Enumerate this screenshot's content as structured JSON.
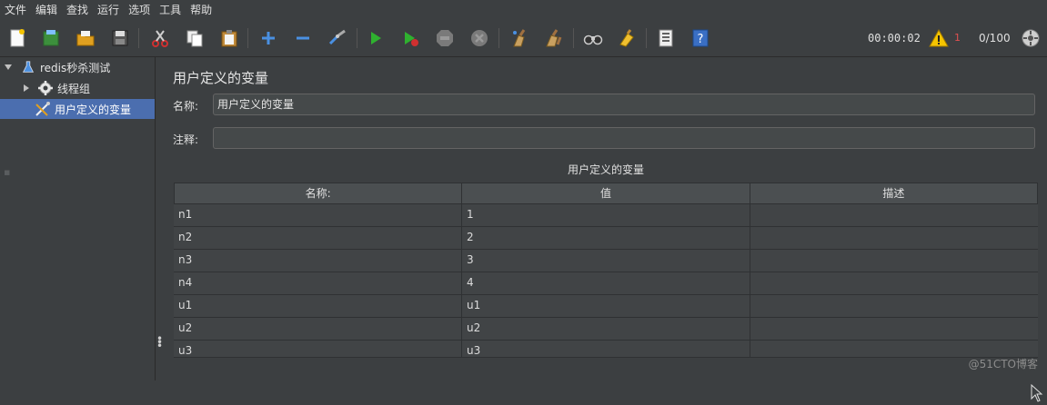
{
  "menu": [
    "文件",
    "编辑",
    "查找",
    "运行",
    "选项",
    "工具",
    "帮助"
  ],
  "toolbar": {
    "icons": [
      "new-icon",
      "templates-icon",
      "open-icon",
      "save-icon",
      "cut-icon",
      "copy-icon",
      "paste-icon",
      "expand-icon",
      "collapse-icon",
      "toggle-icon",
      "start-icon",
      "start-no-pause-icon",
      "stop-icon",
      "shutdown-icon",
      "clear-icon",
      "clear-all-icon",
      "search-icon",
      "reset-search-icon",
      "function-helper-icon",
      "help-icon"
    ],
    "timer": "00:00:02",
    "warn_count": "1",
    "threads": "0/100"
  },
  "tree": {
    "root": "redis秒杀测试",
    "thread_group": "线程组",
    "selected": "用户定义的变量"
  },
  "panel": {
    "title": "用户定义的变量",
    "name_label": "名称:",
    "name_value": "用户定义的变量",
    "comment_label": "注释:",
    "comment_value": "",
    "table_caption": "用户定义的变量",
    "columns": [
      "名称:",
      "值",
      "描述"
    ],
    "rows": [
      [
        "n1",
        "1",
        ""
      ],
      [
        "n2",
        "2",
        ""
      ],
      [
        "n3",
        "3",
        ""
      ],
      [
        "n4",
        "4",
        ""
      ],
      [
        "u1",
        "u1",
        ""
      ],
      [
        "u2",
        "u2",
        ""
      ],
      [
        "u3",
        "u3",
        ""
      ]
    ]
  },
  "watermark": "@51CTO博客",
  "colors": {
    "background": "#3c3f41",
    "selection": "#4b6eaf",
    "field_bg": "#45494a",
    "warning": "#e05050"
  }
}
